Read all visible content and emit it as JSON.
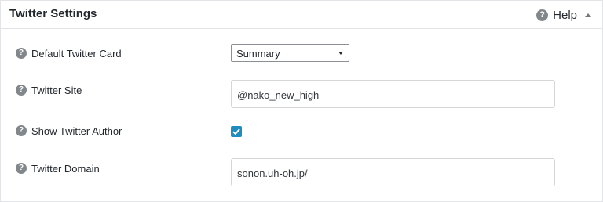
{
  "panel": {
    "title": "Twitter Settings",
    "help_label": "Help"
  },
  "icons": {
    "help": "question-circle-icon",
    "collapse": "triangle-up-icon",
    "field_help": "question-circle-icon",
    "checkmark": "checkmark-icon"
  },
  "fields": {
    "card": {
      "label": "Default Twitter Card",
      "value": "Summary"
    },
    "site": {
      "label": "Twitter Site",
      "value": "@nako_new_high"
    },
    "author": {
      "label": "Show Twitter Author",
      "checked": true
    },
    "domain": {
      "label": "Twitter Domain",
      "value": "sonon.uh-oh.jp/"
    }
  },
  "colors": {
    "accent": "#1e8cbe",
    "help_icon": "#82878c",
    "text": "#23282d"
  }
}
